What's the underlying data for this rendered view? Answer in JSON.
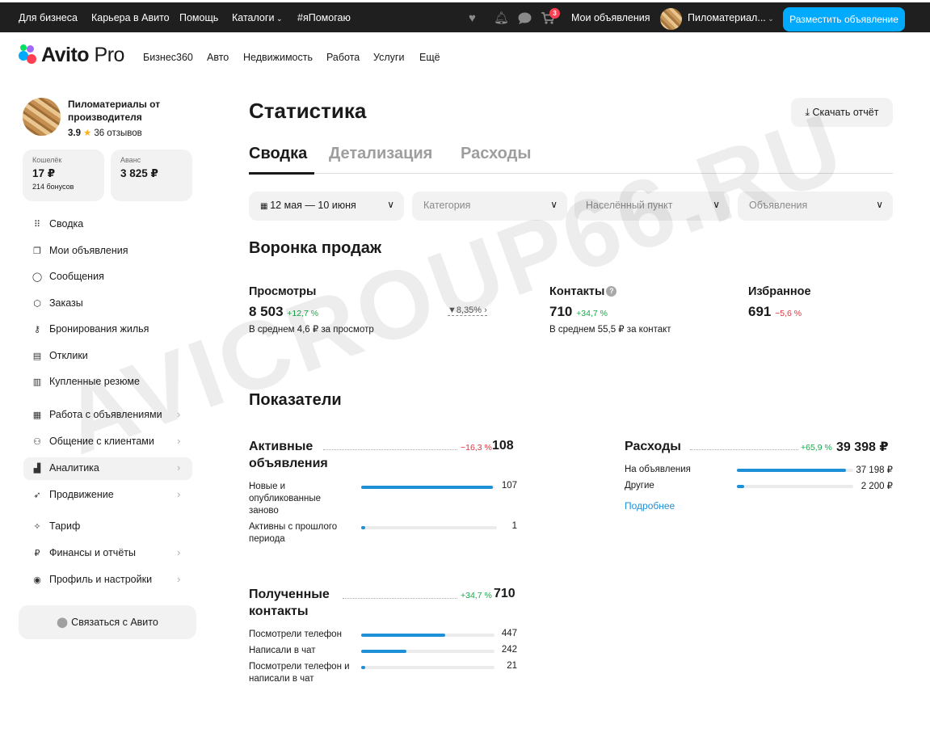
{
  "topbar": {
    "links": [
      "Для бизнеса",
      "Карьера в Авито",
      "Помощь",
      "Каталоги",
      "#яПомогаю"
    ],
    "cart_badge": "3",
    "my_ads": "Мои объявления",
    "user_name": "Пиломатериал...",
    "post_button": "Разместить объявление"
  },
  "nav": {
    "logo_main": "Avito",
    "logo_pro": " Pro",
    "items": [
      "Бизнес360",
      "Авто",
      "Недвижимость",
      "Работа",
      "Услуги",
      "Ещё"
    ]
  },
  "sidebar": {
    "shop_name": "Пиломатериалы от производителя",
    "rating": "3.9",
    "reviews": "36 отзывов",
    "wallet": {
      "label": "Кошелёк",
      "value": "17 ₽",
      "sub": "214 бонусов"
    },
    "advance": {
      "label": "Аванс",
      "value": "3 825 ₽"
    },
    "items": [
      {
        "label": "Сводка",
        "icon": "grid-icon"
      },
      {
        "label": "Мои объявления",
        "icon": "copy-icon"
      },
      {
        "label": "Сообщения",
        "icon": "chat-icon"
      },
      {
        "label": "Заказы",
        "icon": "box-icon"
      },
      {
        "label": "Бронирования жилья",
        "icon": "key-icon"
      },
      {
        "label": "Отклики",
        "icon": "doc-icon"
      },
      {
        "label": "Купленные резюме",
        "icon": "file-icon"
      },
      {
        "label": "Работа с объявлениями",
        "icon": "list-icon"
      },
      {
        "label": "Общение с клиентами",
        "icon": "users-icon"
      },
      {
        "label": "Аналитика",
        "icon": "chart-icon"
      },
      {
        "label": "Продвижение",
        "icon": "rocket-icon"
      },
      {
        "label": "Тариф",
        "icon": "tag-icon"
      },
      {
        "label": "Финансы и отчёты",
        "icon": "ruble-icon"
      },
      {
        "label": "Профиль и настройки",
        "icon": "profile-icon"
      }
    ],
    "contact_avito": "Связаться с Авито"
  },
  "main": {
    "title": "Статистика",
    "download": "Скачать отчёт",
    "tabs": [
      "Сводка",
      "Детализация",
      "Расходы"
    ],
    "filters": {
      "date": "12 мая — 10 июня",
      "category": "Категория",
      "city": "Населённый пункт",
      "ads": "Объявления"
    },
    "funnel": {
      "title": "Воронка продаж",
      "views": {
        "label": "Просмотры",
        "value": "8 503",
        "delta": "+12,7 %",
        "sub": "В среднем 4,6 ₽ за просмотр"
      },
      "conversion": "8,35%",
      "contacts": {
        "label": "Контакты",
        "value": "710",
        "delta": "+34,7 %",
        "sub": "В среднем 55,5 ₽ за контакт"
      },
      "favorites": {
        "label": "Избранное",
        "value": "691",
        "delta": "−5,6 %"
      }
    },
    "metrics": {
      "title": "Показатели",
      "active": {
        "title": "Активные объявления",
        "delta": "−16,3 %",
        "total": "108",
        "rows": [
          {
            "label": "Новые и опубликованные заново",
            "value": "107",
            "fill": 0.99
          },
          {
            "label": "Активны с прошлого периода",
            "value": "1",
            "fill": 0.03
          }
        ]
      },
      "expenses": {
        "title": "Расходы",
        "delta": "+65,9 %",
        "total": "39 398 ₽",
        "rows": [
          {
            "label": "На объявления",
            "value": "37 198 ₽",
            "fill": 0.94
          },
          {
            "label": "Другие",
            "value": "2 200 ₽",
            "fill": 0.06
          }
        ],
        "more": "Подробнее"
      },
      "contacts": {
        "title": "Полученные контакты",
        "delta": "+34,7 %",
        "total": "710",
        "rows": [
          {
            "label": "Посмотрели телефон",
            "value": "447",
            "fill": 0.63
          },
          {
            "label": "Написали в чат",
            "value": "242",
            "fill": 0.34
          },
          {
            "label": "Посмотрели телефон и написали в чат",
            "value": "21",
            "fill": 0.03
          }
        ]
      }
    }
  },
  "watermark": "AVICROUP66.RU"
}
